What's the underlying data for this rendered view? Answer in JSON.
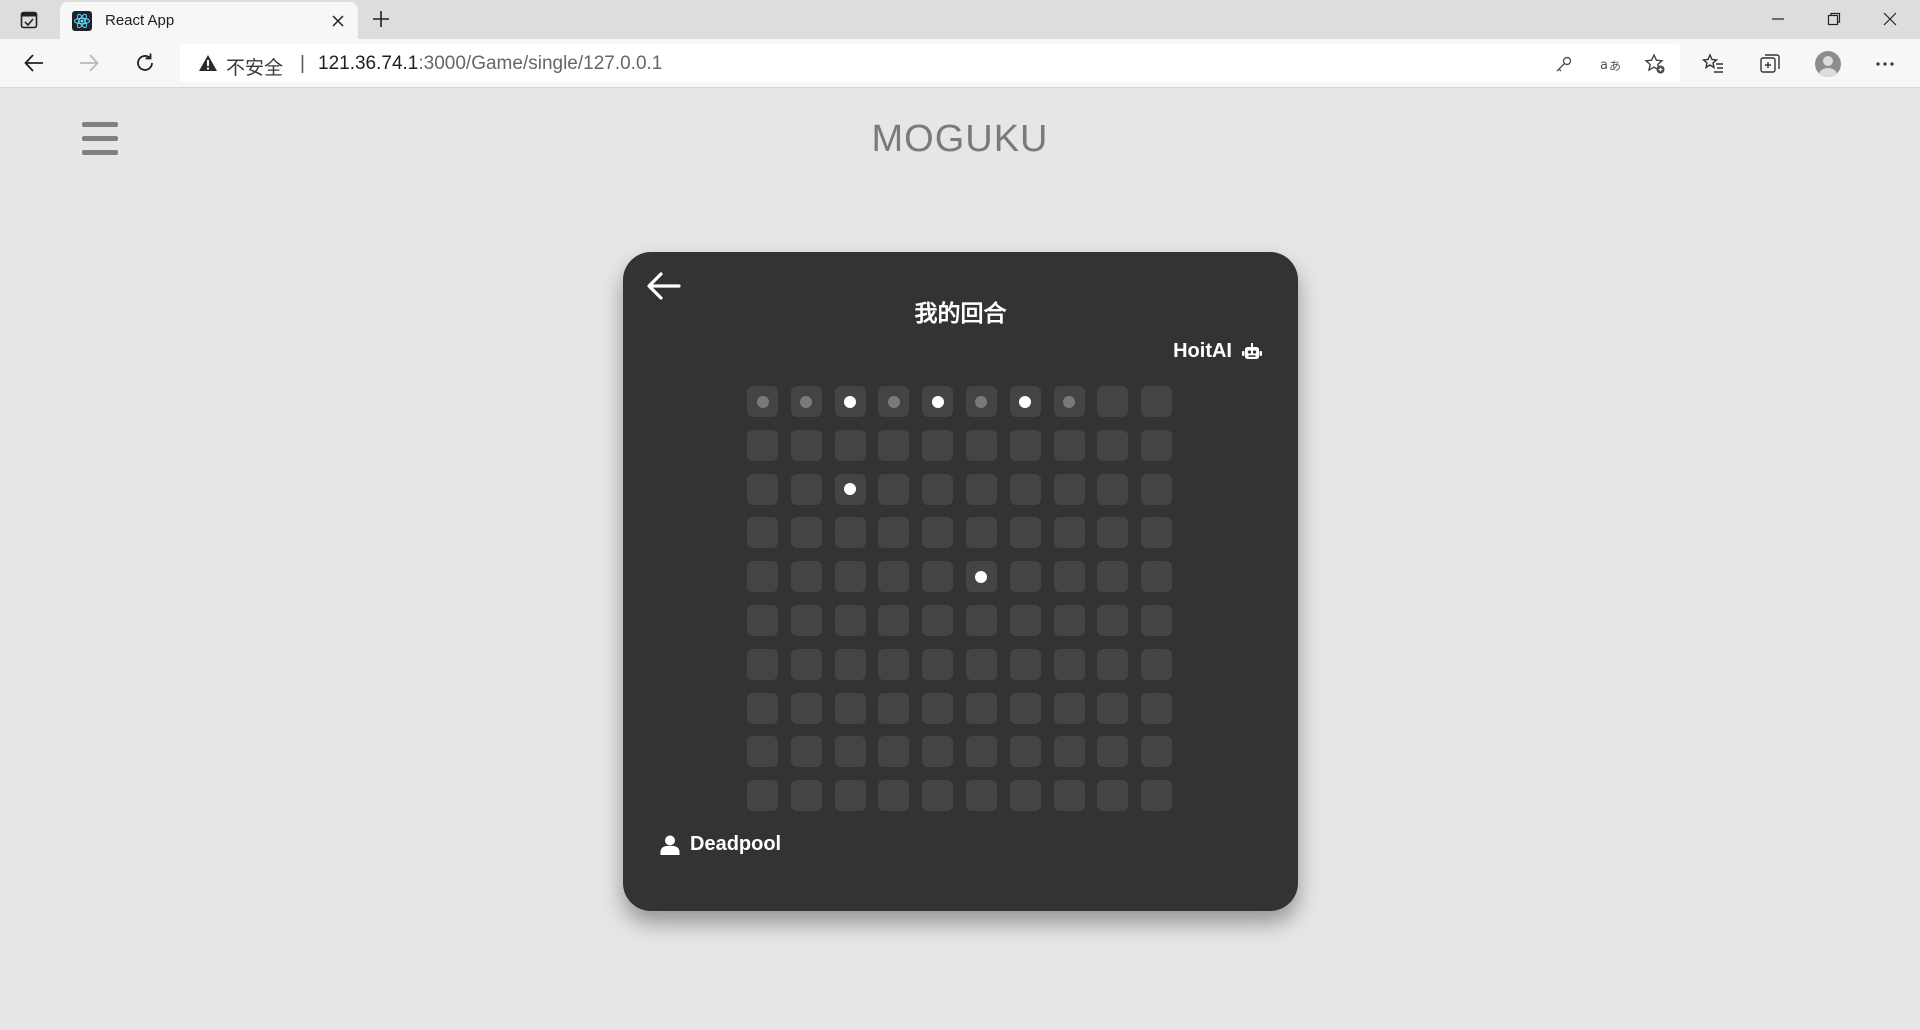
{
  "browser": {
    "tab": {
      "title": "React App"
    },
    "address": {
      "security_label": "不安全",
      "separator": "|",
      "url_host": "121.36.74.1",
      "url_rest": ":3000/Game/single/127.0.0.1"
    }
  },
  "page": {
    "app_title": "MOGUKU",
    "game": {
      "turn_label": "我的回合",
      "opponent_name": "HoitAI",
      "player_name": "Deadpool",
      "board": {
        "rows": 10,
        "cols": 10,
        "stones": [
          {
            "row": 0,
            "col": 0,
            "color": "gray"
          },
          {
            "row": 0,
            "col": 1,
            "color": "gray"
          },
          {
            "row": 0,
            "col": 2,
            "color": "white"
          },
          {
            "row": 0,
            "col": 3,
            "color": "gray"
          },
          {
            "row": 0,
            "col": 4,
            "color": "white"
          },
          {
            "row": 0,
            "col": 5,
            "color": "gray"
          },
          {
            "row": 0,
            "col": 6,
            "color": "white"
          },
          {
            "row": 0,
            "col": 7,
            "color": "gray"
          },
          {
            "row": 2,
            "col": 2,
            "color": "white"
          },
          {
            "row": 4,
            "col": 5,
            "color": "white"
          }
        ]
      }
    }
  },
  "colors": {
    "page_bg": "#e6e6e6",
    "card_bg": "#333333",
    "cell_bg": "#444444",
    "stone_white": "#ffffff",
    "stone_gray": "#7a7a7a"
  }
}
